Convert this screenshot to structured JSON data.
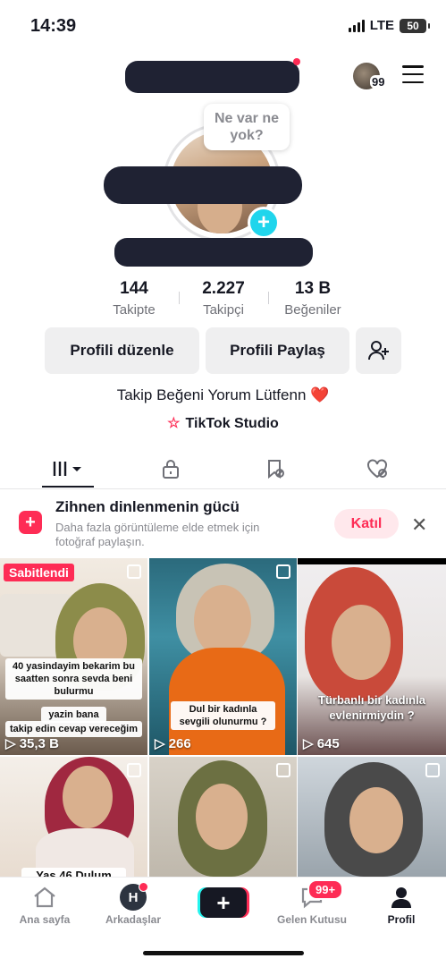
{
  "status_bar": {
    "time": "14:39",
    "network": "LTE",
    "battery": "50"
  },
  "header": {
    "avatar_count": "99"
  },
  "profile": {
    "bubble_text": "Ne var ne yok?"
  },
  "stats": [
    {
      "value": "144",
      "label": "Takipte"
    },
    {
      "value": "2.227",
      "label": "Takipçi"
    },
    {
      "value": "13 B",
      "label": "Beğeniler"
    }
  ],
  "actions": {
    "edit_label": "Profili düzenle",
    "share_label": "Profili Paylaş"
  },
  "bio": {
    "text": "Takip Beğeni Yorum Lütfenn",
    "emoji": "❤️"
  },
  "studio": {
    "label": "TikTok Studio"
  },
  "promo": {
    "title": "Zihnen dinlenmenin gücü",
    "description": "Daha fazla görüntüleme elde etmek için fotoğraf paylaşın.",
    "join_label": "Katıl"
  },
  "videos": [
    {
      "pinned_label": "Sabitlendi",
      "caption1": "40 yasindayim bekarim bu saatten sonra sevda beni bulurmu",
      "caption2": "yazin bana",
      "caption3": "takip edin cevap vereceğim",
      "views": "35,3 B"
    },
    {
      "caption1": "Dul bir kadınla sevgili olunurmu ?",
      "views": "266"
    },
    {
      "caption1": "Türbanlı bir kadınla evlenirmiydin ?",
      "views": "645"
    },
    {
      "caption1": "Yas 46 Dulum"
    },
    {},
    {}
  ],
  "nav": {
    "home": "Ana sayfa",
    "friends": "Arkadaşlar",
    "friends_initial": "H",
    "inbox": "Gelen Kutusu",
    "inbox_badge": "99+",
    "profile": "Profil"
  }
}
